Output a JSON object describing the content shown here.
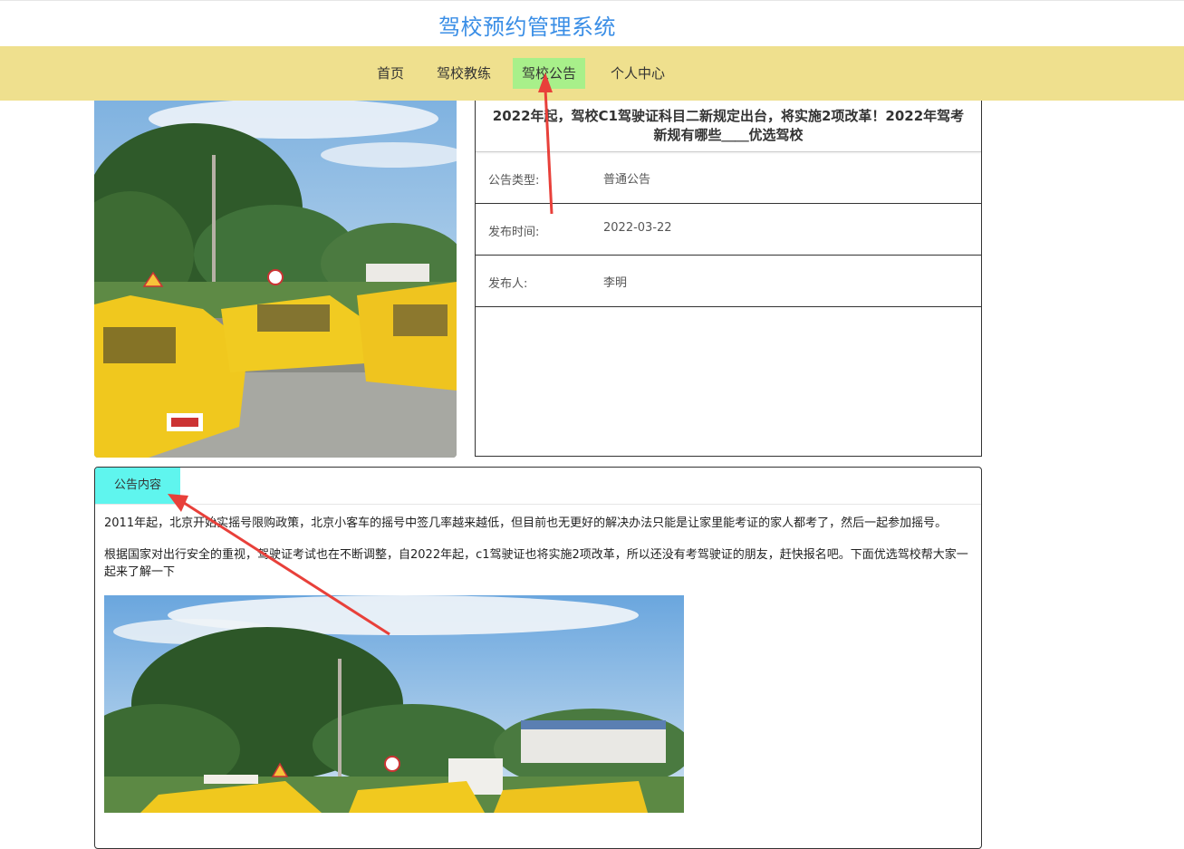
{
  "header": {
    "site_title": "驾校预约管理系统"
  },
  "nav": {
    "items": [
      {
        "label": "首页"
      },
      {
        "label": "驾校教练"
      },
      {
        "label": "驾校公告"
      },
      {
        "label": "个人中心"
      }
    ],
    "active_index": 2,
    "bar_color": "#efe08e",
    "active_color": "#a8f08a"
  },
  "notice": {
    "title": "2022年起，驾校C1驾驶证科目二新规定出台，将实施2项改革！2022年驾考新规有哪些＿＿优选驾校",
    "fields": [
      {
        "label": "公告类型:",
        "value": "普通公告"
      },
      {
        "label": "发布时间:",
        "value": "2022-03-22"
      },
      {
        "label": "发布人:",
        "value": "李明"
      }
    ]
  },
  "content": {
    "tab_label": "公告内容",
    "tab_color": "#5ff5ee",
    "paragraphs": [
      "2011年起，北京开始实摇号限购政策，北京小客车的摇号中签几率越来越低，但目前也无更好的解决办法只能是让家里能考证的家人都考了，然后一起参加摇号。",
      "根据国家对出行安全的重视，驾驶证考试也在不断调整，自2022年起，c1驾驶证也将实施2项改革，所以还没有考驾驶证的朋友，赶快报名吧。下面优选驾校帮大家一起来了解一下"
    ]
  },
  "images": {
    "hero": "driving-school-cars-photo",
    "content": "driving-school-cars-photo"
  },
  "annotations": {
    "arrow_color": "#e8403a"
  }
}
